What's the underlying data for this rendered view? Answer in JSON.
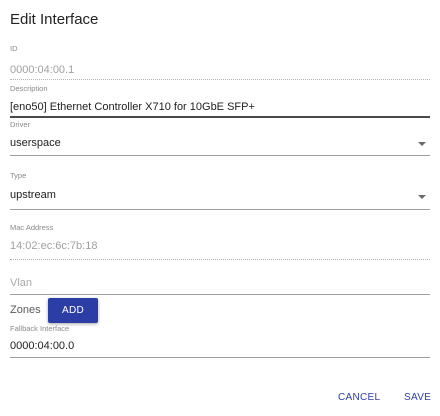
{
  "dialog": {
    "title": "Edit Interface",
    "fields": {
      "id": {
        "label": "ID",
        "value": "0000:04:00.1"
      },
      "description": {
        "label": "Description",
        "value": "[eno50] Ethernet Controller X710 for 10GbE SFP+"
      },
      "driver": {
        "label": "Driver",
        "value": "userspace"
      },
      "type": {
        "label": "Type",
        "value": "upstream"
      },
      "mac": {
        "label": "Mac Address",
        "value": "14:02:ec:6c:7b:18"
      },
      "vlan": {
        "placeholder": "Vlan"
      },
      "zones": {
        "label": "Zones",
        "add_label": "ADD"
      },
      "fallback": {
        "label": "Fallback Interface",
        "value": "0000:04:00.0"
      }
    },
    "actions": {
      "cancel": "CANCEL",
      "save": "SAVE"
    }
  },
  "colors": {
    "accent": "#2c3ea6"
  },
  "icons": {
    "dropdown": "caret-down-icon"
  }
}
